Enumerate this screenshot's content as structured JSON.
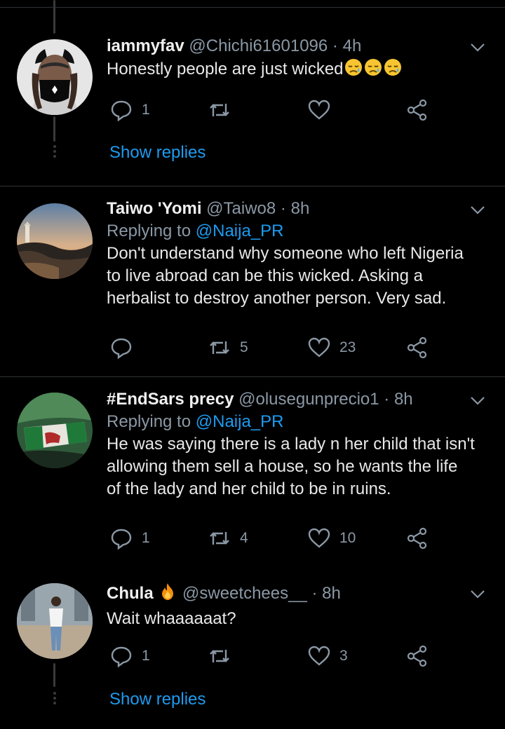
{
  "tweets": [
    {
      "name": "iammyfav",
      "handle": "@Chichi61601096",
      "time": "4h",
      "text": "Honestly people are just wicked",
      "replies": "1",
      "retweets": "",
      "likes": ""
    },
    {
      "name": "Taiwo 'Yomi",
      "handle": "@Taiwo8",
      "time": "8h",
      "replying_label": "Replying to",
      "replying_to": "@Naija_PR",
      "text_lines": [
        "Don't understand why someone who left Nigeria",
        "to live abroad can be this wicked. Asking a",
        "herbalist to destroy another person. Very sad."
      ],
      "replies": "",
      "retweets": "5",
      "likes": "23"
    },
    {
      "name": "#EndSars precy",
      "handle": "@olusegunprecio1",
      "time": "8h",
      "replying_label": "Replying to",
      "replying_to": "@Naija_PR",
      "text_lines": [
        "He was saying there is a lady n her child that isn't",
        "allowing them sell a house, so he wants the life",
        "of the lady and her child to be in ruins."
      ],
      "replies": "1",
      "retweets": "4",
      "likes": "10"
    },
    {
      "name": "Chula",
      "handle": "@sweetchees__",
      "time": "8h",
      "text": "Wait whaaaaaat?",
      "replies": "1",
      "retweets": "",
      "likes": "3"
    }
  ],
  "show_replies_label": "Show replies",
  "separator": "·",
  "icons": {
    "reply": "reply-icon",
    "retweet": "retweet-icon",
    "like": "heart-icon",
    "share": "share-icon",
    "more": "chevron-down-icon",
    "emoji_crying": "sad-tear-emoji",
    "emoji_fire": "fire-emoji"
  },
  "colors": {
    "background": "#000000",
    "link": "#1d9bf0",
    "muted": "#8b98a5",
    "text": "#e8e8e8"
  }
}
